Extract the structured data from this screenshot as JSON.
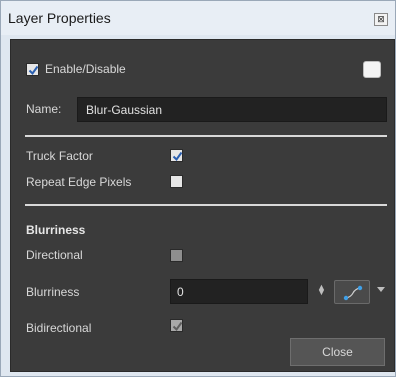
{
  "window": {
    "title": "Layer Properties",
    "close_glyph": "⊠"
  },
  "enable": {
    "label": "Enable/Disable",
    "checked": true
  },
  "name": {
    "label": "Name:",
    "value": "Blur-Gaussian"
  },
  "truck_factor": {
    "label": "Truck Factor",
    "checked": true
  },
  "repeat_edge": {
    "label": "Repeat Edge Pixels",
    "checked": false
  },
  "blurriness_section": {
    "heading": "Blurriness",
    "directional": {
      "label": "Directional",
      "checked": false
    },
    "blurriness": {
      "label": "Blurriness",
      "value": "0"
    },
    "bidirectional": {
      "label": "Bidirectional",
      "checked": true,
      "enabled": false
    }
  },
  "buttons": {
    "close": "Close"
  },
  "icons": {
    "function_button": "function-curve-icon",
    "spin": "spin-arrows-icon",
    "dropdown": "chevron-down-icon"
  },
  "colors": {
    "panel_bg": "#3b3b3b",
    "check_blue": "#2a5fb0"
  }
}
